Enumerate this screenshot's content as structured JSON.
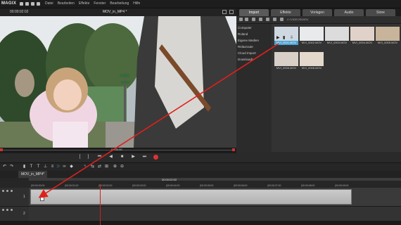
{
  "app": {
    "logo": "MAGIX"
  },
  "menu": [
    "Datei",
    "Bearbeiten",
    "Effekte",
    "Fenster",
    "Bearbeitung",
    "Hilfe"
  ],
  "preview": {
    "timecode": "00:00:02:02",
    "title": "MOV_in_MP4 *"
  },
  "right_panel": {
    "tabs": [
      "Import",
      "Effekte",
      "Vorlagen",
      "Audio",
      "Store"
    ],
    "active_tab": "Import",
    "breadcrumb": "C:\\VIDEOS\\MOV",
    "sources": [
      "Computer",
      "Roland",
      "Eigene Medien",
      "Relaxroute",
      "Cloud Import",
      "Downloads"
    ],
    "thumbnails": [
      {
        "label": "MVI_0001.MOV",
        "selected": true
      },
      {
        "label": "MVI_0002.MOV",
        "selected": false
      },
      {
        "label": "MVI_0003.MOV",
        "selected": false
      },
      {
        "label": "MVI_0004.MOV",
        "selected": false
      },
      {
        "label": "MVI_0005.MOV",
        "selected": false
      },
      {
        "label": "MVI_0006.MOV",
        "selected": false
      },
      {
        "label": "MVI_0008.MOV",
        "selected": false
      }
    ]
  },
  "scrub": {
    "timecode": "00:00:00"
  },
  "timeline": {
    "tab": "MOV_in_MP4*",
    "ruler_timecode": "00:00:02:02",
    "ticks": [
      "|00:00:00:00",
      "|00:00:01:00",
      "|00:00:02:00",
      "|00:00:03:00",
      "|00:00:04:00",
      "|00:00:05:00",
      "|00:00:06:00",
      "|00:00:07:00",
      "|00:00:08:00",
      "|00:00:09:00"
    ],
    "tracks": [
      "1",
      "2"
    ]
  },
  "colors": {
    "accent": "#4aa3d6",
    "record": "#dd3333",
    "arrow": "#e0201a"
  }
}
